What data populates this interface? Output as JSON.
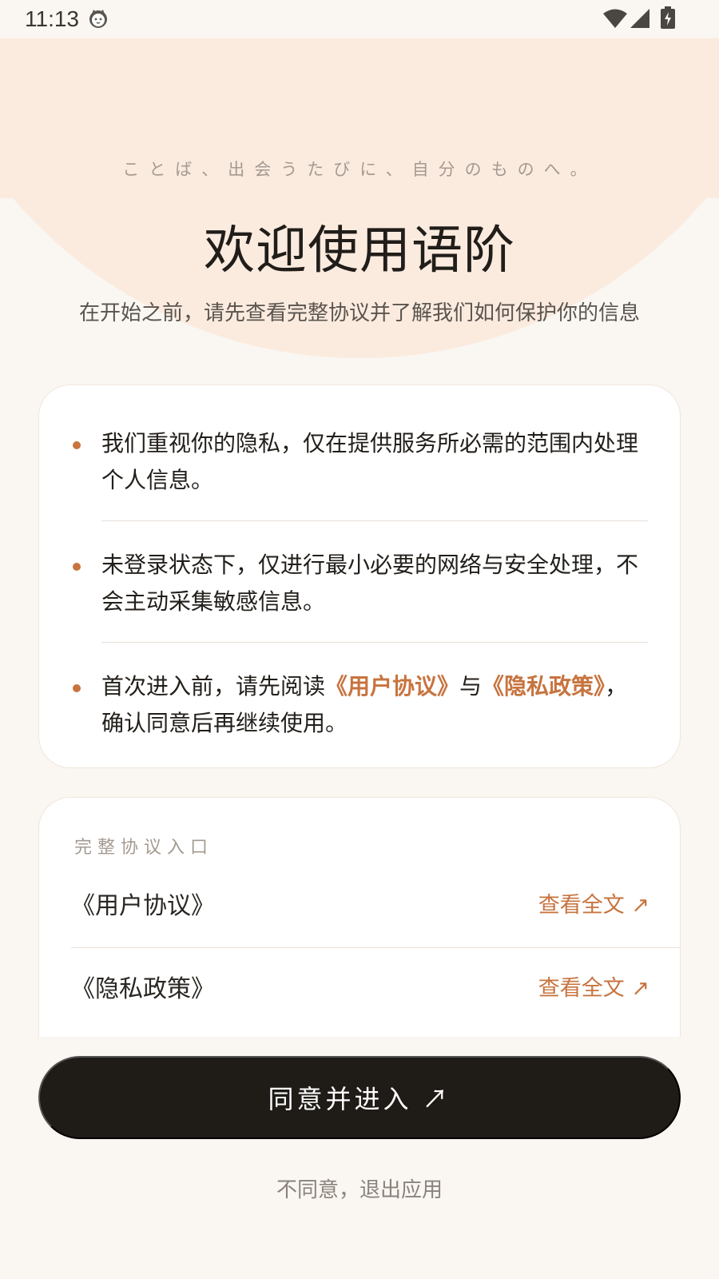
{
  "status_bar": {
    "time": "11:13",
    "icons": [
      "cat-notification-icon",
      "wifi-icon",
      "cell-signal-icon",
      "battery-charging-icon"
    ]
  },
  "hero": {
    "tagline": "ことば、出会うたびに、自分のものへ。",
    "title": "欢迎使用语阶",
    "subtitle": "在开始之前，请先查看完整协议并了解我们如何保护你的信息"
  },
  "info_card": {
    "items": [
      {
        "text": "我们重视你的隐私，仅在提供服务所必需的范围内处理个人信息。"
      },
      {
        "text": "未登录状态下，仅进行最小必要的网络与安全处理，不会主动采集敏感信息。"
      },
      {
        "text_before": "首次进入前，请先阅读",
        "link_user": "《用户协议》",
        "text_mid": "与",
        "link_privacy": "《隐私政策》",
        "text_after": "，确认同意后再继续使用。"
      }
    ]
  },
  "agreements": {
    "heading": "完整协议入口",
    "rows": [
      {
        "name": "《用户协议》",
        "action": "查看全文 ↗"
      },
      {
        "name": "《隐私政策》",
        "action": "查看全文 ↗"
      }
    ]
  },
  "actions": {
    "agree_label": "同意并进入 ↗",
    "decline_label": "不同意，退出应用"
  },
  "colors": {
    "background": "#faf6f2",
    "hero": "#fbebdf",
    "accent": "#c7743f",
    "primary_button": "#1f1b17"
  }
}
